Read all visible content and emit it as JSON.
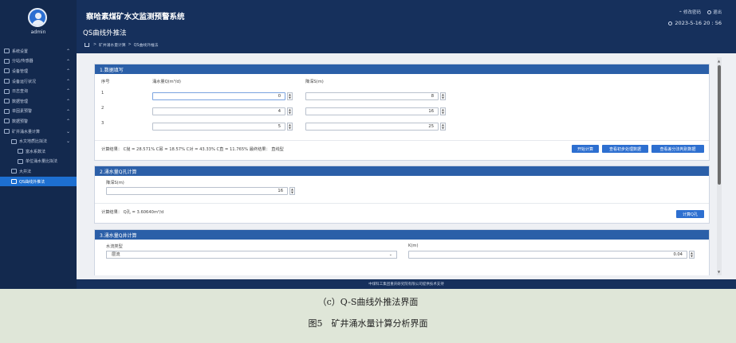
{
  "sidebar": {
    "username": "admin",
    "items": [
      {
        "label": "系统设置",
        "chev": "⌃"
      },
      {
        "label": "分站/传感器",
        "chev": "⌃"
      },
      {
        "label": "设备管理",
        "chev": "⌃"
      },
      {
        "label": "设备运行状况",
        "chev": "⌃"
      },
      {
        "label": "日志查询",
        "chev": "⌃"
      },
      {
        "label": "数据管理",
        "chev": "⌃"
      },
      {
        "label": "单因素预警",
        "chev": "⌃"
      },
      {
        "label": "数据预警",
        "chev": "⌃"
      },
      {
        "label": "矿井涌水量计算",
        "chev": "⌄"
      },
      {
        "label": "水文地质比拟法",
        "chev": "⌄"
      },
      {
        "label": "富水系数法"
      },
      {
        "label": "单位涌水量比拟法"
      },
      {
        "label": "大井法"
      },
      {
        "label": "QS曲线外推法"
      }
    ]
  },
  "header": {
    "system_title": "察哈素煤矿水文监测预警系统",
    "page_title": "QS曲线外推法",
    "breadcrumb": [
      "矿井涌水量计算",
      "QS曲线外推法"
    ],
    "change_password": "修改密码",
    "logout": "退出",
    "datetime": "2023-5-16 20 : 56"
  },
  "section1": {
    "title": "1.数据填写",
    "col_index": "序号",
    "col_q": "涌水量Q(m³/d)",
    "col_s": "降深S(m)",
    "rows": [
      {
        "index": "1",
        "q": "0",
        "s": "8"
      },
      {
        "index": "2",
        "q": "4",
        "s": "16"
      },
      {
        "index": "3",
        "q": "5",
        "s": "25"
      }
    ],
    "result": "计算结果： C抛 = 28.571% C幂 = 18.57% C对 = 43.33% C直 = 11.765% 最终结果： 直线型",
    "btn_calc": "开始计算",
    "btn_preprocess": "查看初步处理数据",
    "btn_diff": "查看差分法判别数据"
  },
  "section2": {
    "title": "2.涌水量Q孔计算",
    "label_s": "降深S(m)",
    "s_value": "16",
    "result": "计算结果： Q孔 = 3.60640m³/d",
    "btn_calc": "计算Q孔"
  },
  "section3": {
    "title": "3.涌水量Q井计算",
    "label_type": "水流类型",
    "type_value": "层流",
    "label_k": "K(m)",
    "k_value": "0.04"
  },
  "footer": {
    "text": "中煤科工集团重庆研究院有限公司提供技术支持"
  },
  "captions": {
    "sub": "（c）Q-S曲线外推法界面",
    "figure": "图5　矿井涌水量计算分析界面"
  },
  "colors": {
    "sidebar_bg": "#13294e",
    "header_bg": "#16305c",
    "panel_header": "#2b5fa8",
    "accent": "#2d6fd0"
  }
}
